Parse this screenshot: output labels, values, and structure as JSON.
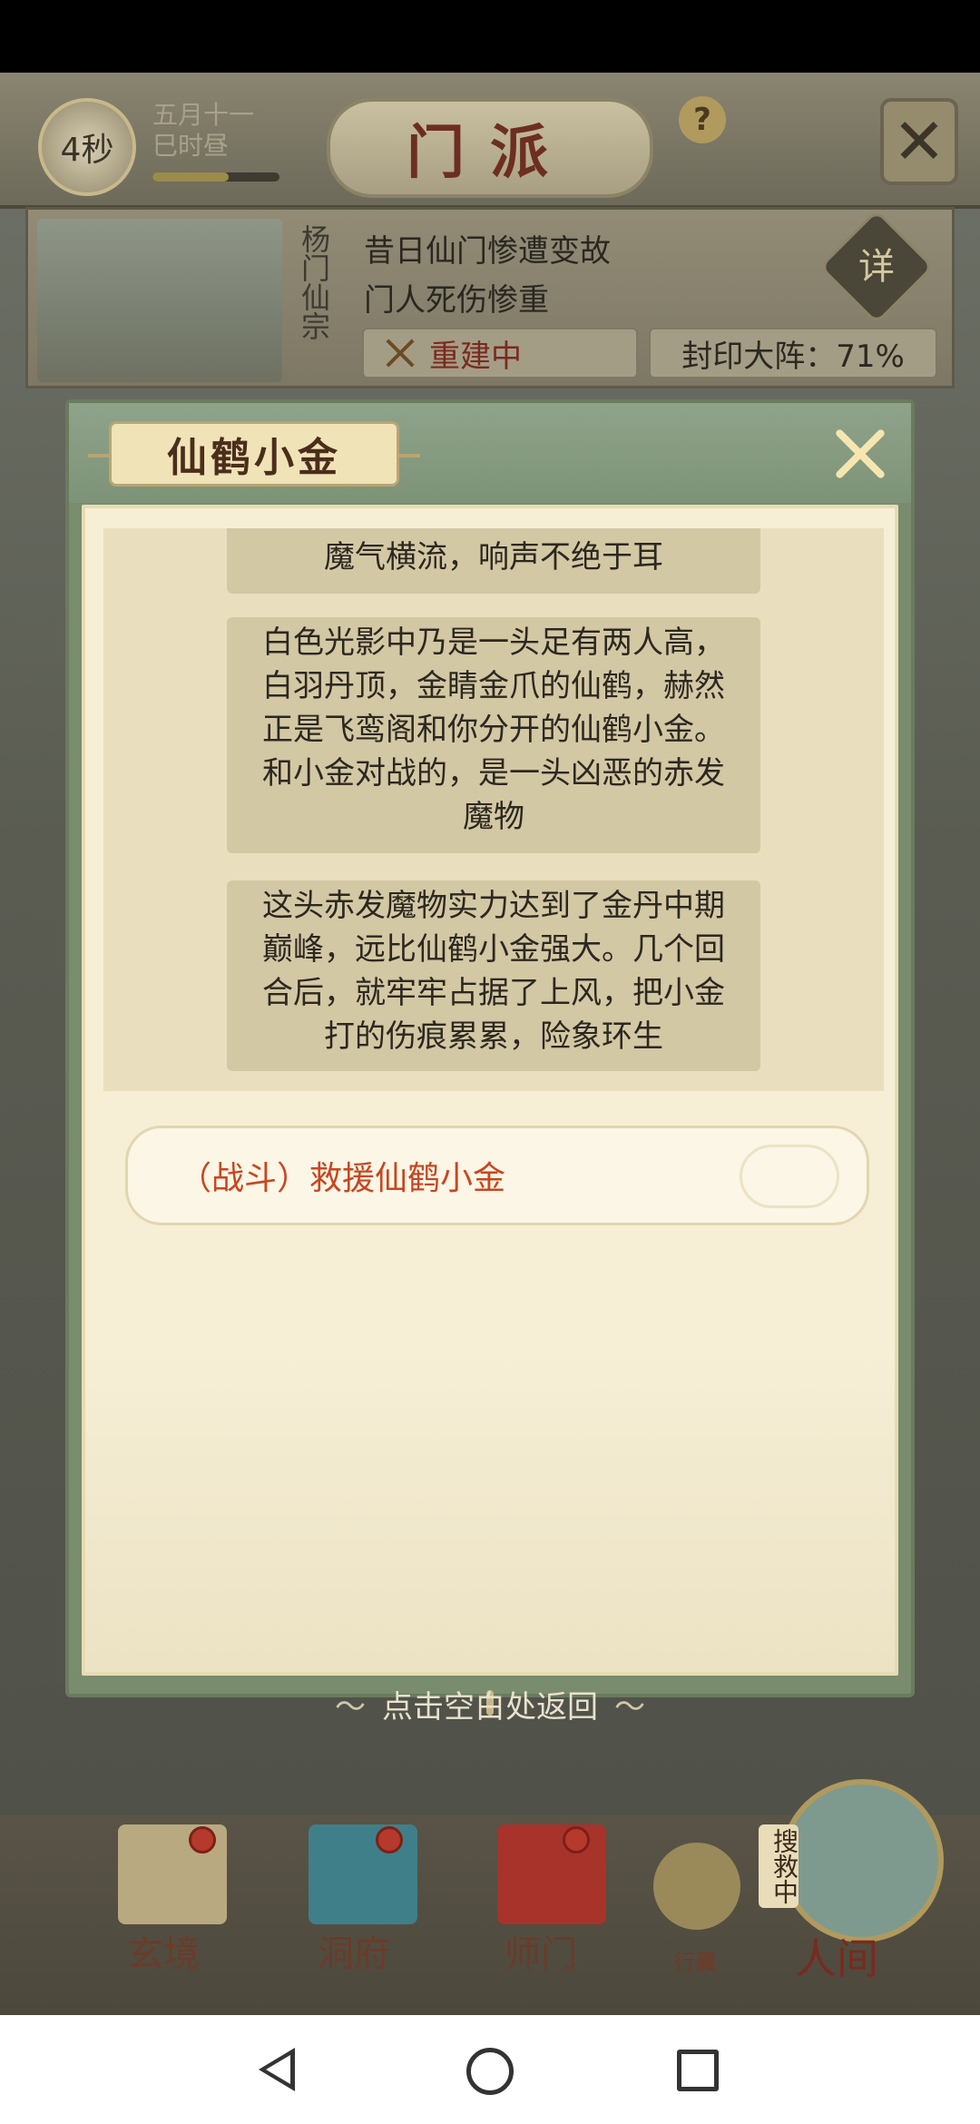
{
  "header": {
    "timer": "4秒",
    "date_line1": "五月十一",
    "date_line2": "巳时昼",
    "title": "门派",
    "help_label": "?"
  },
  "sect": {
    "name": "杨门仙宗",
    "line1": "昔日仙门惨遭变故",
    "line2": "门人死伤惨重",
    "detail_label": "详",
    "rebuild_status": "重建中",
    "seal_status": "封印大阵：71%"
  },
  "modal": {
    "title": "仙鹤小金",
    "story": [
      "魔气横流，响声不绝于耳",
      "白色光影中乃是一头足有两人高，白羽丹顶，金睛金爪的仙鹤，赫然正是飞鸾阁和你分开的仙鹤小金。和小金对战的，是一头凶恶的赤发魔物",
      "这头赤发魔物实力达到了金丹中期巅峰，远比仙鹤小金强大。几个回合后，就牢牢占据了上风，把小金打的伤痕累累，险象环生"
    ],
    "choice_label": "（战斗）救援仙鹤小金"
  },
  "return_hint": "点击空白处返回",
  "bottom_nav": {
    "items": [
      {
        "label": "玄境"
      },
      {
        "label": "洞府"
      },
      {
        "label": "师门"
      },
      {
        "label": "行囊"
      },
      {
        "label": "人间"
      }
    ],
    "searching_label": "搜救中"
  },
  "colors": {
    "choice_text": "#c84620",
    "modal_frame": "#7a8c6e",
    "parchment": "#f6efd6"
  }
}
